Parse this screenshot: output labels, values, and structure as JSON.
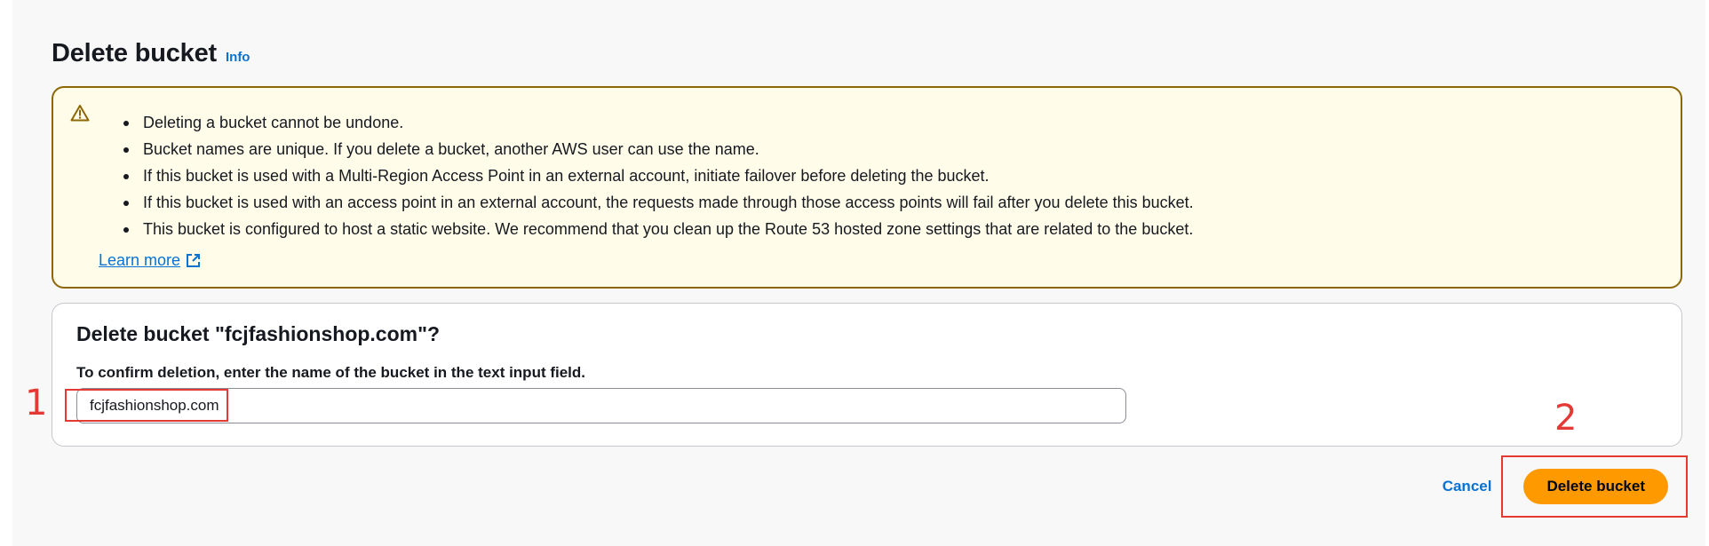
{
  "header": {
    "title": "Delete bucket",
    "info_label": "Info"
  },
  "alert": {
    "icon": "warning-icon",
    "items": [
      "Deleting a bucket cannot be undone.",
      "Bucket names are unique. If you delete a bucket, another AWS user can use the name.",
      "If this bucket is used with a Multi-Region Access Point in an external account, initiate failover before deleting the bucket.",
      "If this bucket is used with an access point in an external account, the requests made through those access points will fail after you delete this bucket.",
      "This bucket is configured to host a static website. We recommend that you clean up the Route 53 hosted zone settings that are related to the bucket."
    ],
    "learn_more_label": "Learn more",
    "border_color": "#8d6605",
    "background_color": "#fffce9"
  },
  "confirm": {
    "title": "Delete bucket \"fcjfashionshop.com\"?",
    "label": "To confirm deletion, enter the name of the bucket in the text input field.",
    "input_value": "fcjfashionshop.com"
  },
  "annotations": {
    "step_1": "1",
    "step_2": "2",
    "color": "#e53935"
  },
  "actions": {
    "cancel_label": "Cancel",
    "delete_label": "Delete bucket",
    "primary_color": "#ff9900",
    "link_color": "#0972d3"
  }
}
